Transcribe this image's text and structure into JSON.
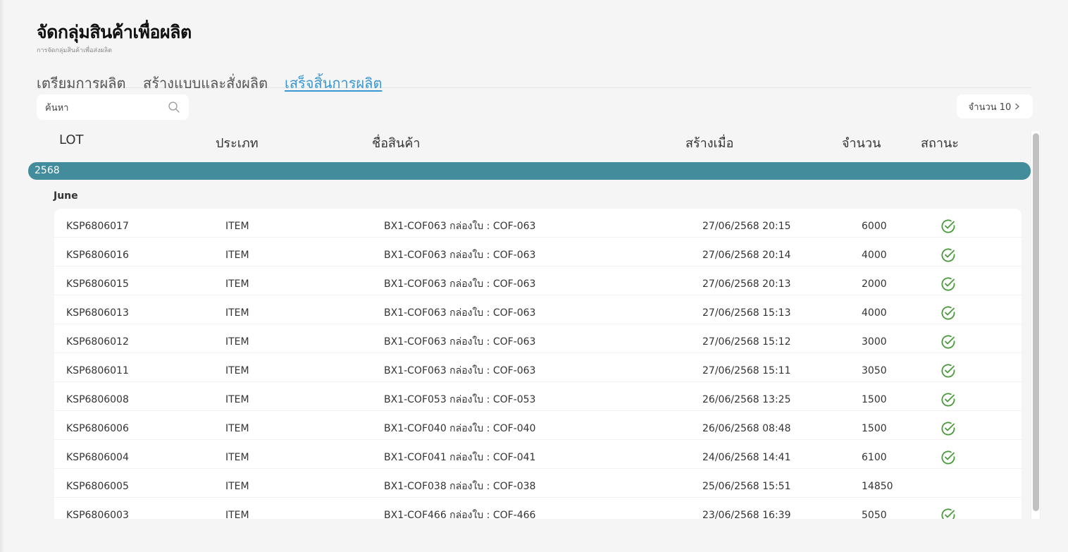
{
  "header": {
    "title": "จัดกลุ่มสินค้าเพื่อผลิต",
    "subtitle": "การจัดกลุ่มสินค้าเพื่อส่งผลิต"
  },
  "tabs": [
    {
      "label": "เตรียมการผลิต",
      "active": false
    },
    {
      "label": "สร้างแบบและสั่งผลิต",
      "active": false
    },
    {
      "label": "เสร็จสิ้นการผลิต",
      "active": true
    }
  ],
  "search": {
    "placeholder": "ค้นหา",
    "value": ""
  },
  "page_size": {
    "label": "จำนวน 10"
  },
  "columns": [
    "LOT",
    "ประเภท",
    "ชื่อสินค้า",
    "สร้างเมื่อ",
    "จำนวน",
    "สถานะ"
  ],
  "group": {
    "year": "2568",
    "month": "June"
  },
  "rows": [
    {
      "lot": "KSP6806017",
      "type": "ITEM",
      "name": "BX1-COF063 กล่องใบ : COF-063",
      "created": "27/06/2568 20:15",
      "qty": "6000",
      "done": true
    },
    {
      "lot": "KSP6806016",
      "type": "ITEM",
      "name": "BX1-COF063 กล่องใบ : COF-063",
      "created": "27/06/2568 20:14",
      "qty": "4000",
      "done": true
    },
    {
      "lot": "KSP6806015",
      "type": "ITEM",
      "name": "BX1-COF063 กล่องใบ : COF-063",
      "created": "27/06/2568 20:13",
      "qty": "2000",
      "done": true
    },
    {
      "lot": "KSP6806013",
      "type": "ITEM",
      "name": "BX1-COF063 กล่องใบ : COF-063",
      "created": "27/06/2568 15:13",
      "qty": "4000",
      "done": true
    },
    {
      "lot": "KSP6806012",
      "type": "ITEM",
      "name": "BX1-COF063 กล่องใบ : COF-063",
      "created": "27/06/2568 15:12",
      "qty": "3000",
      "done": true
    },
    {
      "lot": "KSP6806011",
      "type": "ITEM",
      "name": "BX1-COF063 กล่องใบ : COF-063",
      "created": "27/06/2568 15:11",
      "qty": "3050",
      "done": true
    },
    {
      "lot": "KSP6806008",
      "type": "ITEM",
      "name": "BX1-COF053 กล่องใบ : COF-053",
      "created": "26/06/2568 13:25",
      "qty": "1500",
      "done": true
    },
    {
      "lot": "KSP6806006",
      "type": "ITEM",
      "name": "BX1-COF040 กล่องใบ : COF-040",
      "created": "26/06/2568 08:48",
      "qty": "1500",
      "done": true
    },
    {
      "lot": "KSP6806004",
      "type": "ITEM",
      "name": "BX1-COF041 กล่องใบ : COF-041",
      "created": "24/06/2568 14:41",
      "qty": "6100",
      "done": true
    },
    {
      "lot": "KSP6806005",
      "type": "ITEM",
      "name": "BX1-COF038 กล่องใบ : COF-038",
      "created": "25/06/2568 15:51",
      "qty": "14850",
      "done": false
    },
    {
      "lot": "KSP6806003",
      "type": "ITEM",
      "name": "BX1-COF466 กล่องใบ : COF-466",
      "created": "23/06/2568 16:39",
      "qty": "5050",
      "done": true
    }
  ],
  "colors": {
    "accent": "#3b97d3",
    "group_bar": "#428c9c",
    "status_done": "#4a9a3c"
  },
  "icons": {
    "search": "search-icon",
    "chevron": "chevron-right-icon",
    "status": "check-circle-icon"
  }
}
